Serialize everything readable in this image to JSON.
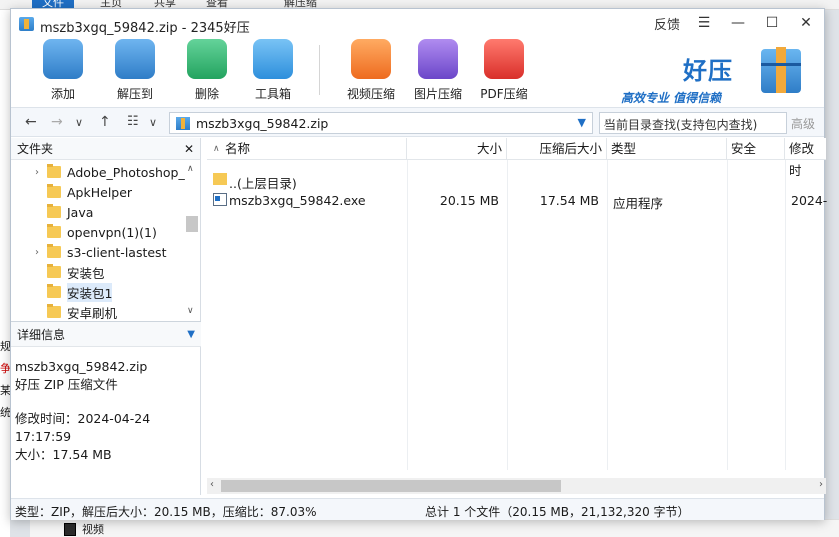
{
  "background": {
    "ribbon_tabs": [
      "文件",
      "主页",
      "共享",
      "查看",
      "解压缩"
    ],
    "left_chars": [
      "规",
      "争",
      "某",
      "统"
    ],
    "video_label": "视频"
  },
  "window": {
    "title": "mszb3xgq_59842.zip - 2345好压",
    "feedback": "反馈",
    "controls": {
      "menu": "☰",
      "minimize": "—",
      "maximize": "☐",
      "close": "✕"
    }
  },
  "toolbar": {
    "buttons": [
      {
        "id": "add",
        "label": "添加",
        "icon": "add-icon",
        "color": "#3e8ee0"
      },
      {
        "id": "extract",
        "label": "解压到",
        "icon": "extract-icon",
        "color": "#3e8ee0"
      },
      {
        "id": "delete",
        "label": "删除",
        "icon": "recycle-icon",
        "color": "#2bb673"
      },
      {
        "id": "tools",
        "label": "工具箱",
        "icon": "toolbox-icon",
        "color": "#3ea0e8"
      },
      {
        "id": "video",
        "label": "视频压缩",
        "icon": "video-compress-icon",
        "color": "#f07f2b"
      },
      {
        "id": "image",
        "label": "图片压缩",
        "icon": "image-compress-icon",
        "color": "#8a62d8"
      },
      {
        "id": "pdf",
        "label": "PDF压缩",
        "icon": "pdf-compress-icon",
        "color": "#e7403c"
      }
    ],
    "brand_name": "好压",
    "brand_slogan": "高效专业  值得信赖"
  },
  "addressbar": {
    "path": "mszb3xgq_59842.zip",
    "search_placeholder": "当前目录查找(支持包内查找)",
    "advanced": "高级"
  },
  "leftpane": {
    "title": "文件夹",
    "close": "✕",
    "folders": [
      {
        "name": "Adobe_Photoshop_",
        "expandable": true
      },
      {
        "name": "ApkHelper",
        "expandable": false
      },
      {
        "name": "Java",
        "expandable": false
      },
      {
        "name": "openvpn(1)(1)",
        "expandable": false
      },
      {
        "name": "s3-client-lastest",
        "expandable": true
      },
      {
        "name": "安装包",
        "expandable": false
      },
      {
        "name": "安装包1",
        "expandable": false,
        "selected": true
      },
      {
        "name": "安卓刷机",
        "expandable": false
      }
    ],
    "details_title": "详细信息",
    "details": {
      "filename": "mszb3xgq_59842.zip",
      "type": "好压 ZIP 压缩文件",
      "modified": "修改时间：2024-04-24 17:17:59",
      "size": "大小：17.54 MB"
    }
  },
  "filelist": {
    "columns": [
      "名称",
      "大小",
      "压缩后大小",
      "类型",
      "安全",
      "修改时"
    ],
    "up_row": "..(上层目录)",
    "rows": [
      {
        "name": "mszb3xgq_59842.exe",
        "size": "20.15 MB",
        "packed": "17.54 MB",
        "type": "应用程序",
        "security": "",
        "modified": "2024-"
      }
    ]
  },
  "statusbar": {
    "left": "类型：ZIP，解压后大小：20.15 MB，压缩比：87.03%",
    "right": "总计 1 个文件（20.15 MB，21,132,320 字节）"
  }
}
